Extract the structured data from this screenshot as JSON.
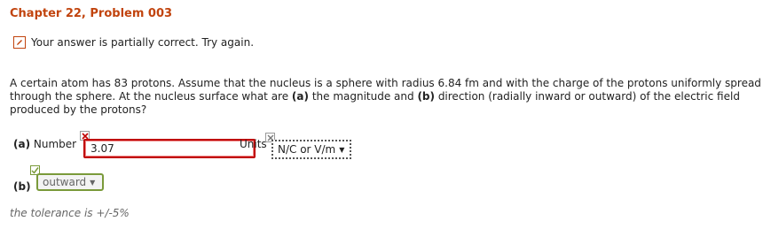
{
  "header": {
    "title": "Chapter 22, Problem 003"
  },
  "status": {
    "message": "Your answer is partially correct.  Try again."
  },
  "question": {
    "text_1": "A certain atom has 83 protons. Assume that the nucleus is a sphere with radius 6.84 fm and with the charge of the protons uniformly spread through the sphere. At the nucleus surface what are ",
    "part_a": "(a)",
    "text_2": " the magnitude and ",
    "part_b": "(b)",
    "text_3": " direction (radially inward or outward) of the electric field produced by the protons?"
  },
  "part_a": {
    "label_prefix": "(a)",
    "label_text": " Number",
    "value": "3.07",
    "units_label": "Units",
    "units_value": "N/C or V/m"
  },
  "part_b": {
    "label": "(b)",
    "value": "outward"
  },
  "footer": {
    "tolerance": "the tolerance is +/-5%"
  },
  "colors": {
    "title": "#c1440e",
    "error": "#c00000",
    "correct": "#7a9a3a"
  },
  "icons": [
    "pencil-icon",
    "x-icon",
    "check-icon",
    "dropdown-arrow-icon"
  ]
}
